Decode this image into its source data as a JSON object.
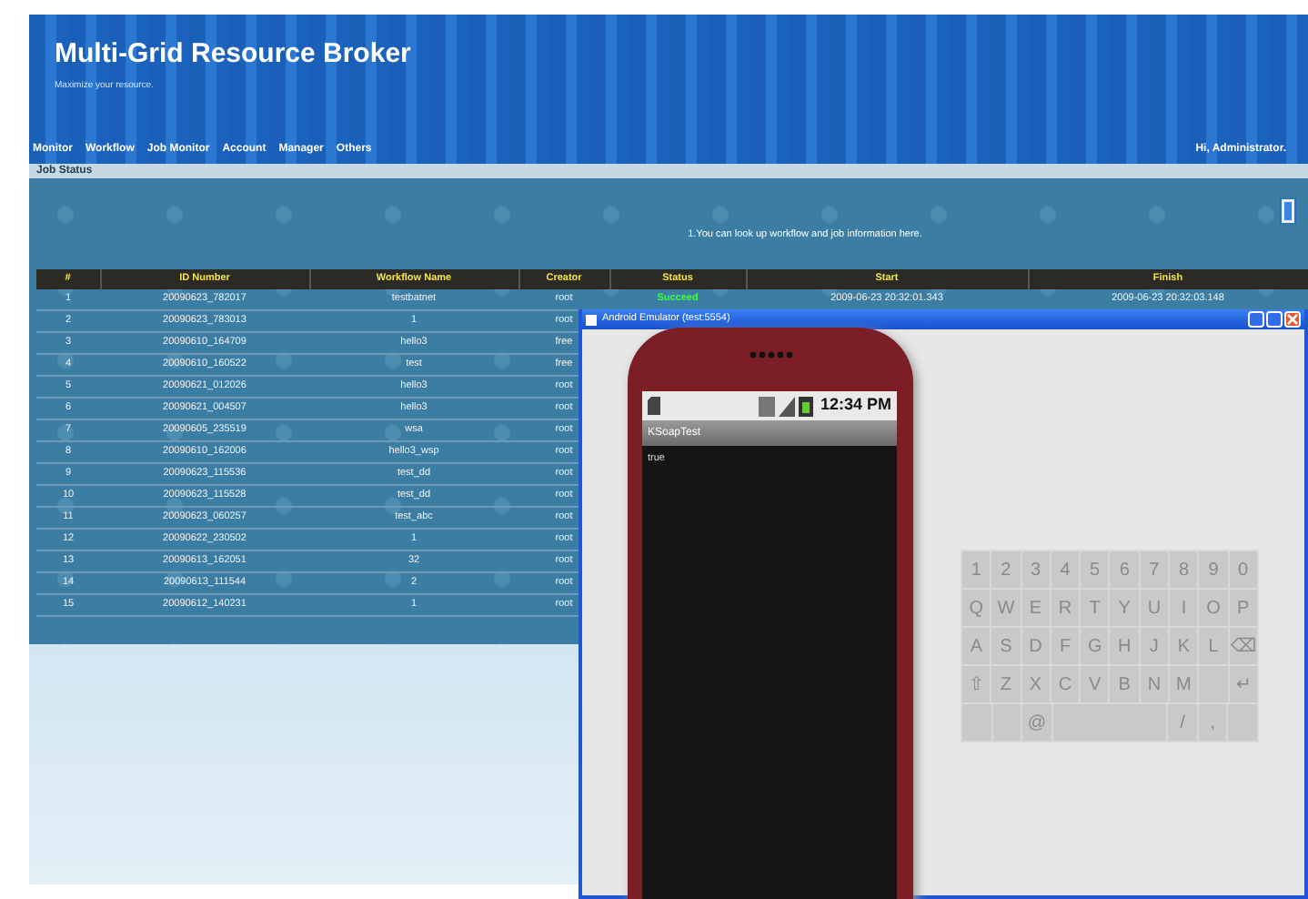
{
  "header": {
    "title": "Multi-Grid Resource Broker",
    "subtitle": "Maximize your resource."
  },
  "nav": [
    {
      "label": "Monitor"
    },
    {
      "label": "Workflow"
    },
    {
      "label": "Job Monitor"
    },
    {
      "label": "Account"
    },
    {
      "label": "Manager"
    },
    {
      "label": "Others"
    }
  ],
  "greeting": "Hi, Administrator.",
  "panel": {
    "title": "Job Status",
    "hint": "1.You can look up workflow and job information here."
  },
  "table": {
    "columns": [
      "#",
      "ID Number",
      "Workflow Name",
      "Creator",
      "Status",
      "Start",
      "Finish"
    ],
    "rows": [
      {
        "cells": [
          "1",
          "20090623_782017",
          "testbatnet",
          "root",
          "Succeed",
          "2009-06-23 20:32:01.343",
          "2009-06-23 20:32:03.148"
        ]
      },
      {
        "cells": [
          "2",
          "20090623_783013",
          "1",
          "root"
        ]
      },
      {
        "cells": [
          "3",
          "20090610_164709",
          "hello3",
          "free"
        ]
      },
      {
        "cells": [
          "4",
          "20090610_160522",
          "test",
          "free"
        ]
      },
      {
        "cells": [
          "5",
          "20090621_012026",
          "hello3",
          "root"
        ]
      },
      {
        "cells": [
          "6",
          "20090621_004507",
          "hello3",
          "root"
        ]
      },
      {
        "cells": [
          "7",
          "20090605_235519",
          "wsa",
          "root"
        ]
      },
      {
        "cells": [
          "8",
          "20090610_162006",
          "hello3_wsp",
          "root"
        ]
      },
      {
        "cells": [
          "9",
          "20090623_115536",
          "test_dd",
          "root"
        ]
      },
      {
        "cells": [
          "10",
          "20090623_115528",
          "test_dd",
          "root"
        ]
      },
      {
        "cells": [
          "11",
          "20090623_060257",
          "test_abc",
          "root"
        ]
      },
      {
        "cells": [
          "12",
          "20090622_230502",
          "1",
          "root"
        ]
      },
      {
        "cells": [
          "13",
          "20090613_162051",
          "32",
          "root"
        ]
      },
      {
        "cells": [
          "14",
          "20090613_111544",
          "2",
          "root"
        ]
      },
      {
        "cells": [
          "15",
          "20090612_140231",
          "1",
          "root"
        ]
      }
    ]
  },
  "emulator": {
    "title": "Android Emulator (test:5554)",
    "phone": {
      "time": "12:34 PM",
      "app_title": "KSoapTest",
      "content": "true"
    },
    "keyboard": [
      [
        "1",
        "2",
        "3",
        "4",
        "5",
        "6",
        "7",
        "8",
        "9",
        "0"
      ],
      [
        "Q",
        "W",
        "E",
        "R",
        "T",
        "Y",
        "U",
        "I",
        "O",
        "P"
      ],
      [
        "A",
        "S",
        "D",
        "F",
        "G",
        "H",
        "J",
        "K",
        "L",
        "⌫"
      ],
      [
        "⇧",
        "Z",
        "X",
        "C",
        "V",
        "B",
        "N",
        "M",
        "↵"
      ],
      [
        "@",
        "/",
        ","
      ]
    ]
  }
}
